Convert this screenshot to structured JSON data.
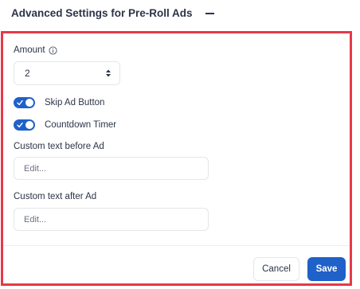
{
  "header": {
    "title": "Advanced Settings for Pre-Roll Ads",
    "collapse_icon": "minus-icon"
  },
  "amount": {
    "label": "Amount",
    "info_icon": "info-icon",
    "value": "2"
  },
  "toggles": [
    {
      "label": "Skip Ad Button",
      "on": true
    },
    {
      "label": "Countdown Timer",
      "on": true
    }
  ],
  "custom_before": {
    "label": "Custom text before Ad",
    "placeholder": "Edit..."
  },
  "custom_after": {
    "label": "Custom text after Ad",
    "placeholder": "Edit..."
  },
  "buttons": {
    "cancel": "Cancel",
    "save": "Save"
  },
  "colors": {
    "accent": "#1f61c9",
    "highlight_border": "#e53948"
  }
}
